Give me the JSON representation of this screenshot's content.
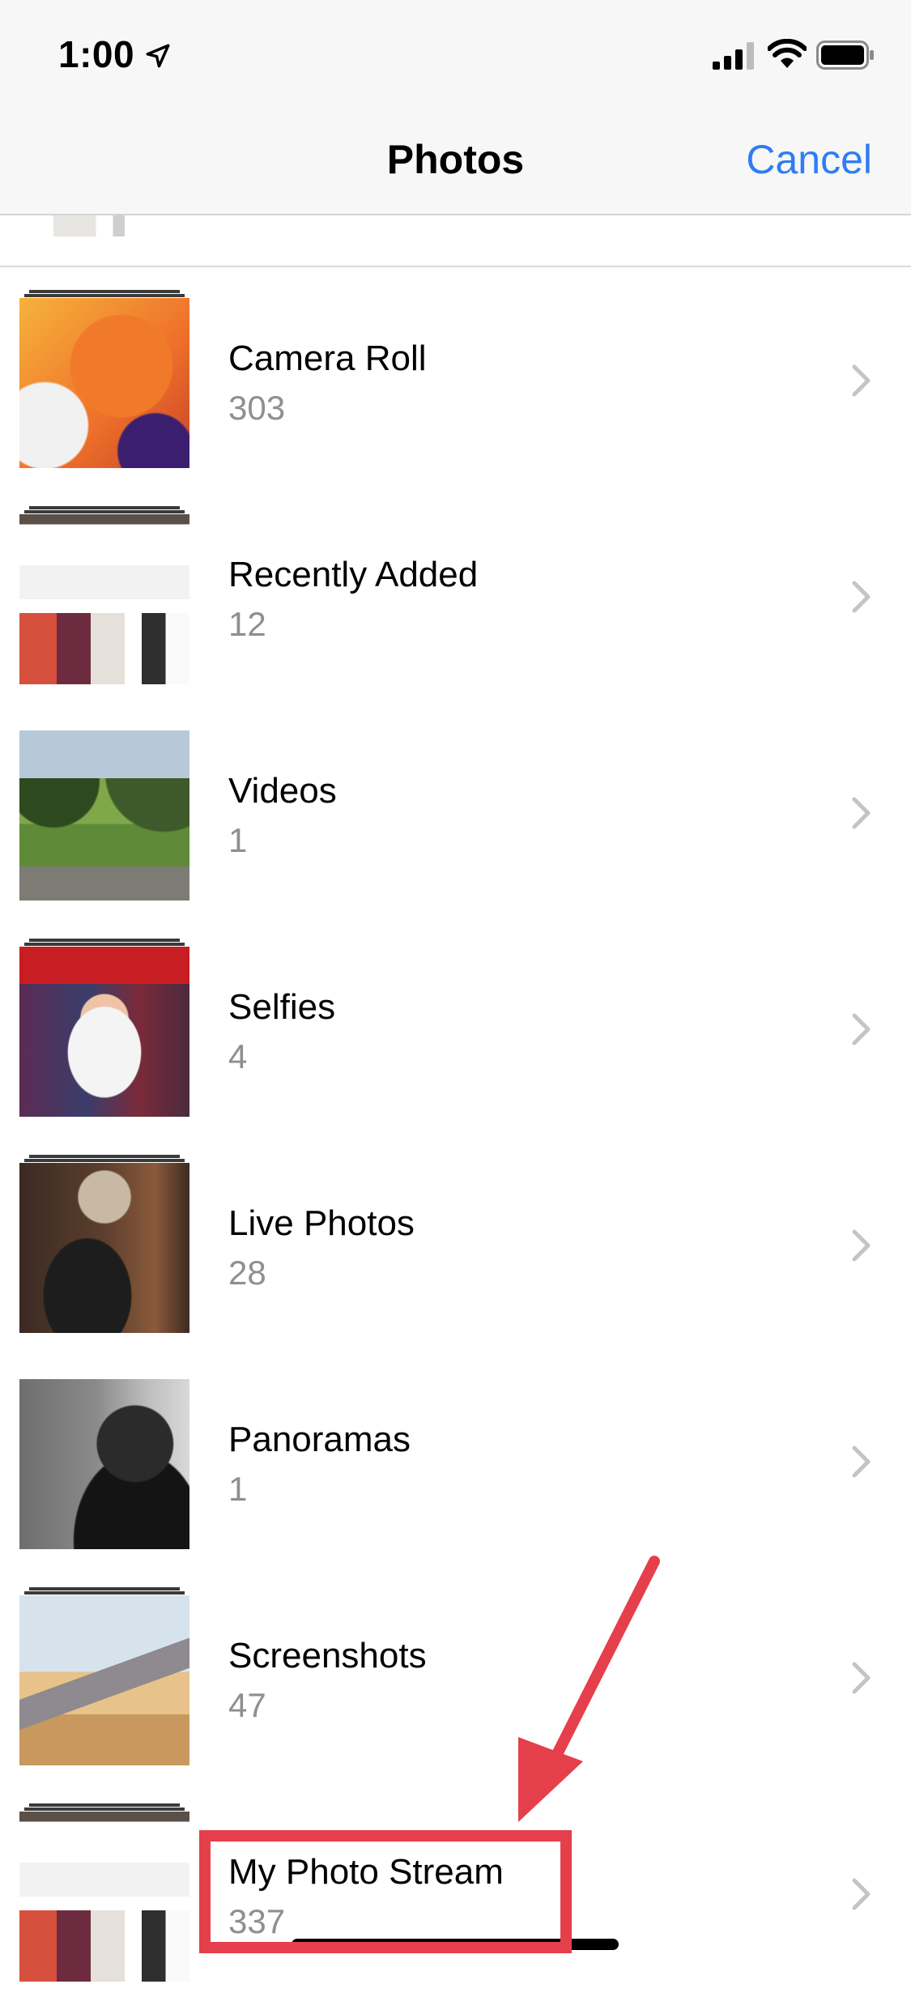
{
  "status_bar": {
    "time": "1:00"
  },
  "nav": {
    "title": "Photos",
    "cancel_label": "Cancel"
  },
  "albums": [
    {
      "title": "Camera Roll",
      "count": "303"
    },
    {
      "title": "Recently Added",
      "count": "12"
    },
    {
      "title": "Videos",
      "count": "1"
    },
    {
      "title": "Selfies",
      "count": "4"
    },
    {
      "title": "Live Photos",
      "count": "28"
    },
    {
      "title": "Panoramas",
      "count": "1"
    },
    {
      "title": "Screenshots",
      "count": "47"
    },
    {
      "title": "My Photo Stream",
      "count": "337"
    }
  ],
  "annotation": {
    "color": "#e53f4b"
  },
  "accent": "#2f7cf6"
}
